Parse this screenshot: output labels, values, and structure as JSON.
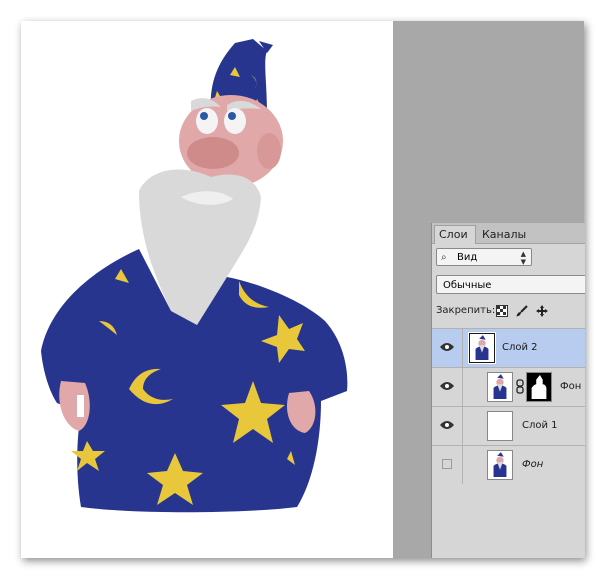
{
  "document": {
    "image": "wizard-character",
    "colors": {
      "robe": "#27358f",
      "star": "#e8c83a",
      "beard": "#d9d9d9",
      "skin": "#e0a8a8"
    }
  },
  "layers_panel": {
    "tabs": [
      {
        "label": "Слои",
        "active": true
      },
      {
        "label": "Каналы",
        "active": false
      }
    ],
    "kind_filter": {
      "value": "Вид"
    },
    "blend_mode": {
      "value": "Обычные"
    },
    "lock": {
      "label": "Закрепить:",
      "icons": [
        "lock-transparent-icon",
        "lock-paint-brush-icon",
        "lock-move-icon"
      ]
    },
    "layers": [
      {
        "name": "Слой 2",
        "visible": true,
        "selected": true,
        "thumbnail": "wizard",
        "has_mask": false,
        "italic": false
      },
      {
        "name": "Фон",
        "visible": true,
        "selected": false,
        "thumbnail": "wizard",
        "has_mask": true,
        "italic": false
      },
      {
        "name": "Слой 1",
        "visible": true,
        "selected": false,
        "thumbnail": "blank",
        "has_mask": false,
        "italic": false
      },
      {
        "name": "Фон",
        "visible": false,
        "selected": false,
        "thumbnail": "wizard",
        "has_mask": false,
        "italic": true
      }
    ],
    "colors": {
      "selected_row": "#b7ccee",
      "panel_bg": "#d6d6d6"
    }
  }
}
